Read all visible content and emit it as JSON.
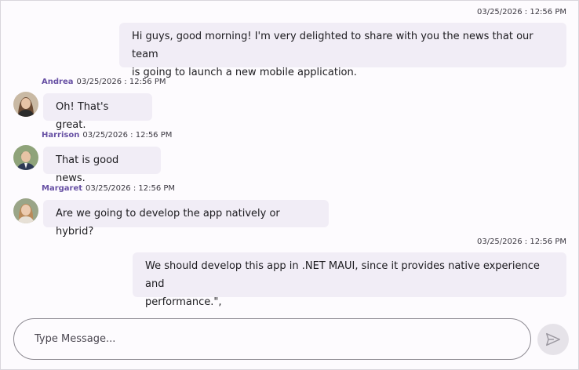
{
  "messages": [
    {
      "direction": "outgoing",
      "timestamp": "03/25/2026 : 12:56 PM",
      "lines": [
        "Hi guys, good morning! I'm very delighted to share with you the news that our team",
        "is going to launch a new mobile application."
      ]
    },
    {
      "direction": "incoming",
      "author": "Andrea",
      "timestamp": "03/25/2026 : 12:56 PM",
      "text": "Oh! That's great.",
      "avatar": "woman-portrait"
    },
    {
      "direction": "incoming",
      "author": "Harrison",
      "timestamp": "03/25/2026 : 12:56 PM",
      "text": "That is good news.",
      "avatar": "man-portrait"
    },
    {
      "direction": "incoming",
      "author": "Margaret",
      "timestamp": "03/25/2026 : 12:56 PM",
      "text": "Are we going to develop the app natively or hybrid?",
      "avatar": "woman-portrait"
    },
    {
      "direction": "outgoing",
      "timestamp": "03/25/2026 : 12:56 PM",
      "lines": [
        "We should develop this app in .NET MAUI, since it provides native experience and",
        "performance.\","
      ]
    }
  ],
  "composer": {
    "placeholder": "Type Message...",
    "send_icon": "send-icon"
  },
  "colors": {
    "background": "#fdfbfe",
    "bubble": "#f1edf6",
    "author": "#6750a4",
    "send_button": "#e6e3e9"
  }
}
